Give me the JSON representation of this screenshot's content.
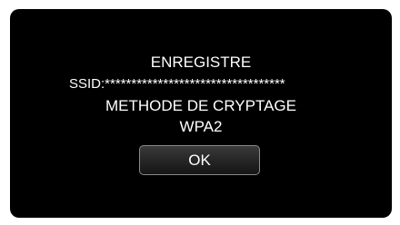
{
  "dialog": {
    "title": "ENREGISTRE",
    "ssid_line": "SSID:**********************************",
    "method_label": "METHODE DE CRYPTAGE",
    "method_value": "WPA2",
    "ok_label": "OK"
  }
}
